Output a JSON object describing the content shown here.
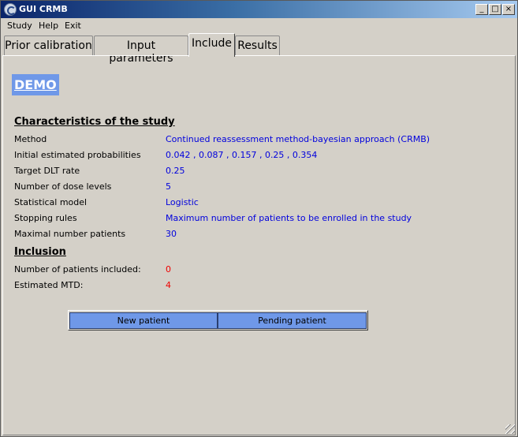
{
  "window": {
    "title": "GUI CRMB",
    "min_glyph": "_",
    "max_glyph": "□",
    "close_glyph": "×"
  },
  "menu": {
    "items": [
      "Study",
      "Help",
      "Exit"
    ]
  },
  "tabs": [
    {
      "label": "Prior calibration",
      "active": false
    },
    {
      "label": "Input parameters",
      "active": false
    },
    {
      "label": "Include",
      "active": true
    },
    {
      "label": "Results",
      "active": false
    }
  ],
  "demo_label": "DEMO",
  "characteristics": {
    "heading": "Characteristics of the study",
    "rows": [
      {
        "label": "Method",
        "value": "Continued reassessment method-bayesian approach (CRMB)"
      },
      {
        "label": "Initial estimated probabilities",
        "value": "0.042 , 0.087 , 0.157 , 0.25 , 0.354"
      },
      {
        "label": "Target DLT rate",
        "value": "0.25"
      },
      {
        "label": "Number of dose levels",
        "value": "5"
      },
      {
        "label": "Statistical model",
        "value": "Logistic"
      },
      {
        "label": "Stopping rules",
        "value": "Maximum number of patients to be enrolled in the study"
      },
      {
        "label": "Maximal number patients",
        "value": "30"
      }
    ]
  },
  "inclusion": {
    "heading": "Inclusion",
    "rows": [
      {
        "label": "Number of patients included:",
        "value": "0"
      },
      {
        "label": "Estimated MTD:",
        "value": "4"
      }
    ]
  },
  "buttons": {
    "new_patient": "New patient",
    "pending_patient": "Pending patient"
  },
  "colors": {
    "value_blue": "#0000dd",
    "value_red": "#ee0000",
    "accent_blue": "#6f98e8",
    "window_bg": "#d4d0c8"
  }
}
